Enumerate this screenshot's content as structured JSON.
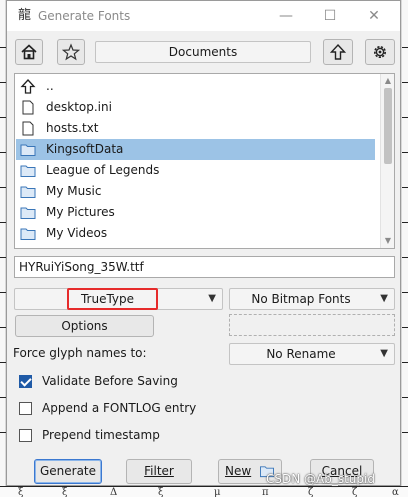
{
  "window": {
    "title": "Generate Fonts",
    "app_icon_glyph": "龍",
    "controls": {
      "minimize": "—",
      "maximize": "☐",
      "close": "✕"
    }
  },
  "toolbar": {
    "home_icon": "home-icon",
    "bookmark_icon": "star-icon",
    "location": "Documents",
    "up_icon": "up-arrow-icon",
    "settings_icon": "gear-icon"
  },
  "file_list": {
    "items": [
      {
        "label": "..",
        "icon": "up-arrow-icon",
        "selected": false
      },
      {
        "label": "desktop.ini",
        "icon": "file-icon",
        "selected": false
      },
      {
        "label": "hosts.txt",
        "icon": "file-icon",
        "selected": false
      },
      {
        "label": "KingsoftData",
        "icon": "folder-icon",
        "selected": true
      },
      {
        "label": "League of Legends",
        "icon": "folder-icon",
        "selected": false
      },
      {
        "label": "My Music",
        "icon": "folder-icon",
        "selected": false
      },
      {
        "label": "My Pictures",
        "icon": "folder-icon",
        "selected": false
      },
      {
        "label": "My Videos",
        "icon": "folder-icon",
        "selected": false
      }
    ]
  },
  "filename": {
    "value": "HYRuiYiSong_35W.ttf"
  },
  "outline_format": {
    "selected": "TrueType"
  },
  "bitmap_format": {
    "selected": "No Bitmap Fonts"
  },
  "options_button": "Options",
  "force_glyph": {
    "label": "Force glyph names to:",
    "selected": "No Rename"
  },
  "checkboxes": [
    {
      "label": "Validate Before Saving",
      "checked": true
    },
    {
      "label": "Append a FONTLOG entry",
      "checked": false
    },
    {
      "label": "Prepend timestamp",
      "checked": false
    }
  ],
  "buttons": {
    "generate": "Generate",
    "filter": "Filter",
    "new": "New",
    "cancel": "Cancel"
  },
  "watermark": "CSDN @Ab_stupid",
  "backdrop_glyphs": [
    "ξ",
    "ξ",
    "Δ",
    "ξ",
    "μ",
    "π",
    "ζ",
    "ζ",
    "α"
  ],
  "colors": {
    "selection": "#9cc3e6",
    "highlight_border": "#e62b2b",
    "checkbox": "#1f5aa6",
    "folder_fill": "#dce9f7",
    "folder_stroke": "#3a76b8"
  }
}
